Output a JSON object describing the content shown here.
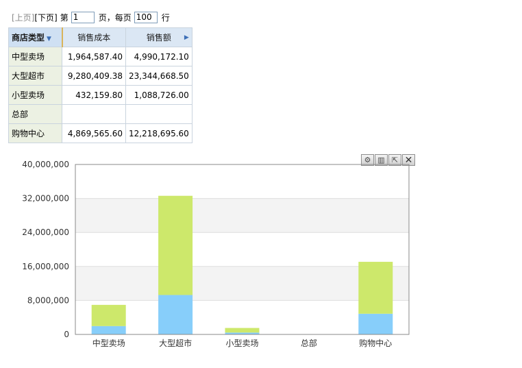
{
  "pager": {
    "prev": "[上页]",
    "next": "[下页]",
    "page_prefix": "第",
    "page_value": "1",
    "page_suffix": "页，每页",
    "rows_value": "100",
    "rows_suffix": "行"
  },
  "table": {
    "headers": [
      "商店类型",
      "销售成本",
      "销售额"
    ],
    "rows": [
      {
        "type": "中型卖场",
        "cost": "1,964,587.40",
        "sales": "4,990,172.10"
      },
      {
        "type": "大型超市",
        "cost": "9,280,409.38",
        "sales": "23,344,668.50"
      },
      {
        "type": "小型卖场",
        "cost": "432,159.80",
        "sales": "1,088,726.00"
      },
      {
        "type": "总部",
        "cost": "",
        "sales": ""
      },
      {
        "type": "购物中心",
        "cost": "4,869,565.60",
        "sales": "12,218,695.60"
      }
    ]
  },
  "chart_tools": [
    "gear-icon",
    "chart-icon",
    "export-icon",
    "close-icon"
  ],
  "chart_data": {
    "type": "bar",
    "stacked": true,
    "categories": [
      "中型卖场",
      "大型超市",
      "小型卖场",
      "总部",
      "购物中心"
    ],
    "series": [
      {
        "values": [
          1964587.4,
          9280409.38,
          432159.8,
          0,
          4869565.6
        ],
        "color": "#87cefa"
      },
      {
        "values": [
          4990172.1,
          23344668.5,
          1088726.0,
          0,
          12218695.6
        ],
        "color": "#cde86b"
      }
    ],
    "yticks": [
      "0",
      "8,000,000",
      "16,000,000",
      "24,000,000",
      "32,000,000",
      "40,000,000"
    ],
    "ylim": [
      0,
      40000000
    ],
    "grid": true
  }
}
